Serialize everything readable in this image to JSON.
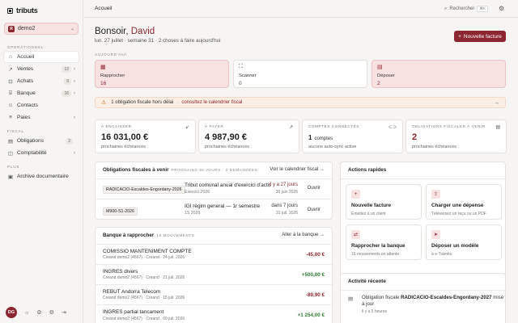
{
  "brand": {
    "name": "tributs"
  },
  "workspace": {
    "badge": "R",
    "name": "demo2"
  },
  "nav": {
    "section_ops": "OPERATIONNEL",
    "items": [
      {
        "label": "Accueil",
        "icon": "home-icon",
        "glyph": "⌂"
      },
      {
        "label": "Ventes",
        "icon": "trend-icon",
        "glyph": "↗",
        "count": "12"
      },
      {
        "label": "Achats",
        "icon": "cart-icon",
        "glyph": "⊡",
        "count": "9"
      },
      {
        "label": "Banque",
        "icon": "bank-icon",
        "glyph": "⌸",
        "count": "16"
      },
      {
        "label": "Contacts",
        "icon": "contacts-icon",
        "glyph": "☺"
      },
      {
        "label": "Paies",
        "icon": "payroll-icon",
        "glyph": "≡"
      }
    ],
    "section_fiscal": "FISCAL",
    "fiscal_items": [
      {
        "label": "Obligations",
        "icon": "doc-icon",
        "glyph": "▤",
        "count": "2"
      },
      {
        "label": "Comptabilité",
        "icon": "ledger-icon",
        "glyph": "◫"
      }
    ],
    "section_plus": "PLUS",
    "plus_items": [
      {
        "label": "Archive documentaire",
        "icon": "archive-icon",
        "glyph": "▣"
      }
    ]
  },
  "user": {
    "initials": "DG"
  },
  "topbar": {
    "breadcrumb": "Accueil",
    "search_label": "Rechercher",
    "shortcut": "⌘K"
  },
  "greeting": {
    "prefix": "Bonsoir, ",
    "name": "David",
    "subline": "lun. 27 juillet · semaine 31 · 2 choses à faire aujourd'hui"
  },
  "new_invoice_label": "Nouvelle facture",
  "today_label": "AUJOURD'HUI",
  "tiles": [
    {
      "label": "Rapprocher",
      "value": "16"
    },
    {
      "label": "Scanner",
      "value": "0"
    },
    {
      "label": "Déposer",
      "value": "2"
    }
  ],
  "alert": {
    "text": "1 obligation fiscale hors délai",
    "link": "consultez le calendrier fiscal"
  },
  "kpis": [
    {
      "label": "À ENCAISSER",
      "value": "16 031,00 €",
      "sub": "prochaines échéances"
    },
    {
      "label": "À PAYER",
      "value": "4 987,90 €",
      "sub": "prochaines échéances"
    },
    {
      "label": "COMPTES CONNECTÉS",
      "value": "1",
      "unit": "comptes",
      "sub": "aucune auto-sync active"
    },
    {
      "label": "OBLIGATIONS FISCALES À VENIR",
      "value": "2",
      "sub": "prochaines échéances"
    }
  ],
  "obligations": {
    "title": "Obligations fiscales à venir",
    "meta": "PROCHAINS 30 JOURS · 2 DEMANDÉES",
    "link": "Voir le calendrier fiscal",
    "rows": [
      {
        "badge": "RADICACIO-Escaldes-Engordany-2026",
        "title": "Tribut comunal anual d'exercici d'activitats",
        "sub": "Exercici 2026",
        "due": "il y a 27 jours",
        "date": "30 juin 2026",
        "open": "Ouvrir"
      },
      {
        "badge": "M900-S1-2026",
        "title": "IGI règim general — 1r semestre",
        "sub": "1S 2026",
        "due": "dans 7 jours",
        "date": "31 juil. 2026",
        "open": "Ouvrir"
      }
    ]
  },
  "reconcile": {
    "title": "Banque à rapprocher",
    "meta": "16 MOUVEMENTS",
    "link": "Aller à la banque",
    "rows": [
      {
        "name": "COMISSIO MANTENIMENT COMPTE",
        "sub": "Creand demo2 (4567) · Creand · 24 juil. 2026",
        "amount": "-45,00 €",
        "neg": true
      },
      {
        "name": "INGRES divers",
        "sub": "Creand demo2 (4567) · Creand · 21 juil. 2026",
        "amount": "+500,00 €",
        "neg": false
      },
      {
        "name": "REBUT Andorra Telecom",
        "sub": "Creand demo2 (4567) · Creand · 15 juil. 2026",
        "amount": "-89,90 €",
        "neg": true
      },
      {
        "name": "INGRES partial tancament",
        "sub": "Creand demo2 (4567) · Creand · 09 juil. 2026",
        "amount": "+1 254,00 €",
        "neg": false
      }
    ]
  },
  "quick": {
    "title": "Actions rapides",
    "items": [
      {
        "title": "Nouvelle facture",
        "sub": "Émettez à un client",
        "glyph": "+"
      },
      {
        "title": "Charger une dépense",
        "sub": "Téléversez un reçu ou un PDF",
        "glyph": "⇪"
      },
      {
        "title": "Rapprocher la banque",
        "sub": "16 mouvements en attente",
        "glyph": "⇄"
      },
      {
        "title": "Déposer un modèle",
        "sub": "à e-Tràmits",
        "glyph": "➤"
      }
    ]
  },
  "activity": {
    "title": "Activité récente",
    "items": [
      {
        "pre": "Obligation fiscale ",
        "bold": "RADICACIO-Escaldes-Engordany-2027",
        "post": " mise à jour",
        "time": "il y a 5 heures"
      }
    ]
  },
  "colors": {
    "accent": "#8c2630",
    "pink_bg": "#f8e1e1",
    "positive": "#2f7d32"
  }
}
